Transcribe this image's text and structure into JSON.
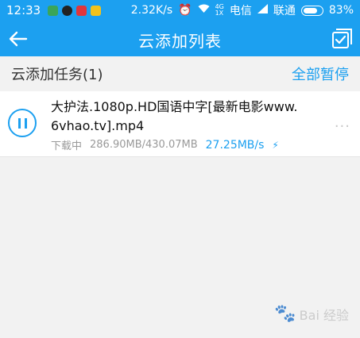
{
  "status_bar": {
    "time": "12:33",
    "net_speed": "2.32K/s",
    "carrier1": "电信",
    "carrier2": "联通",
    "net1_label": "4G",
    "net2_label": "1X",
    "battery": "83%"
  },
  "header": {
    "title": "云添加列表"
  },
  "section": {
    "title": "云添加任务(1)",
    "pause_all": "全部暂停"
  },
  "task": {
    "filename": "大护法.1080p.HD国语中字[最新电影www.6vhao.tv].mp4",
    "status": "下载中",
    "progress": "286.90MB/430.07MB",
    "speed": "27.25MB/s",
    "more": "···"
  },
  "colors": {
    "accent": "#1ca0f0"
  },
  "watermark": {
    "text": "Bai 经验",
    "paw": "🐾"
  }
}
